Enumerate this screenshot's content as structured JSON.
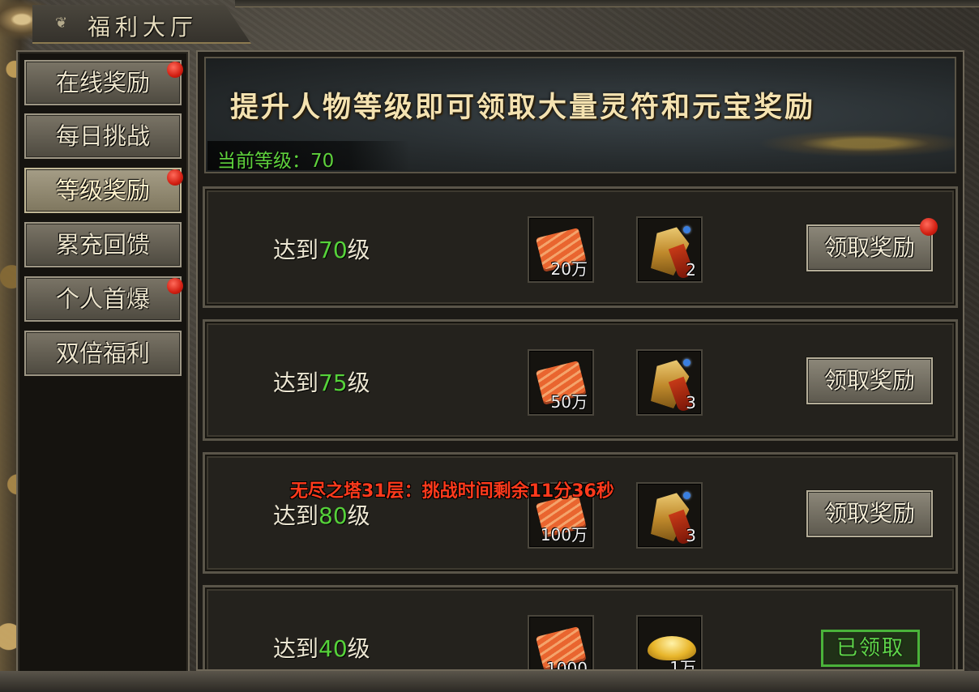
{
  "window": {
    "title": "福利大厅",
    "title_icon": "ornament-icon"
  },
  "sidebar": {
    "items": [
      {
        "label": "在线奖励",
        "badge": true,
        "active": false
      },
      {
        "label": "每日挑战",
        "badge": false,
        "active": false
      },
      {
        "label": "等级奖励",
        "badge": true,
        "active": true
      },
      {
        "label": "累充回馈",
        "badge": false,
        "active": false
      },
      {
        "label": "个人首爆",
        "badge": true,
        "active": false
      },
      {
        "label": "双倍福利",
        "badge": false,
        "active": false
      }
    ]
  },
  "banner": {
    "title": "提升人物等级即可领取大量灵符和元宝奖励",
    "current_level_label": "当前等级：",
    "current_level": "70"
  },
  "rows": [
    {
      "prefix": "达到",
      "level": "70",
      "suffix": "级",
      "item1": {
        "icon": "lingfu-ticket-icon",
        "count": "20万"
      },
      "item2": {
        "icon": "talisman-icon",
        "count": "2"
      },
      "action": "领取奖励",
      "badge": true
    },
    {
      "prefix": "达到",
      "level": "75",
      "suffix": "级",
      "item1": {
        "icon": "lingfu-ticket-icon",
        "count": "50万"
      },
      "item2": {
        "icon": "talisman-icon",
        "count": "3"
      },
      "action": "领取奖励",
      "badge": false
    },
    {
      "prefix": "达到",
      "level": "80",
      "suffix": "级",
      "item1": {
        "icon": "lingfu-ticket-icon",
        "count": "100万"
      },
      "item2": {
        "icon": "talisman-icon",
        "count": "3"
      },
      "action": "领取奖励",
      "badge": false
    },
    {
      "prefix": "达到",
      "level": "40",
      "suffix": "级",
      "item1": {
        "icon": "lingfu-ticket-icon",
        "count": "1000"
      },
      "item2": {
        "icon": "gold-ingot-icon",
        "count": "1万"
      },
      "action": "已领取",
      "claimed": true
    }
  ],
  "notice": "无尽之塔31层：挑战时间剩余11分36秒",
  "colors": {
    "level_green": "#56d23a",
    "notice_red": "#ff3a1c",
    "badge_red": "#d21f12",
    "claimed_green": "#4ab33a"
  }
}
